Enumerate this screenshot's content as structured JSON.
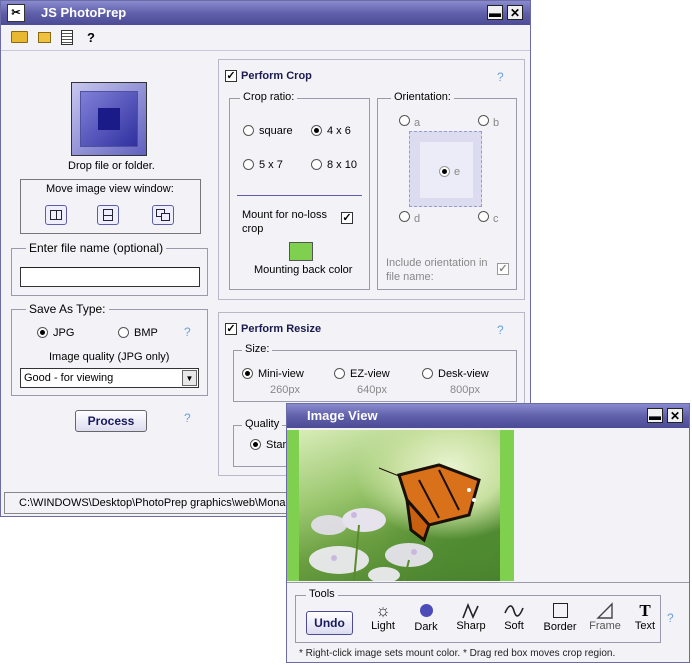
{
  "main": {
    "title": "JS PhotoPrep",
    "toolbar": {
      "help_label": "?"
    },
    "drop": {
      "label": "Drop file or folder."
    },
    "move_view": {
      "label": "Move image view window:"
    },
    "file_name": {
      "label": "Enter file name (optional)",
      "value": ""
    },
    "save_as": {
      "label": "Save As Type:",
      "jpg_label": "JPG",
      "bmp_label": "BMP",
      "selected": "JPG",
      "quality_label": "Image quality (JPG only)",
      "quality_value": "Good - for viewing",
      "help": "?"
    },
    "process": {
      "label": "Process",
      "help": "?"
    },
    "crop": {
      "enabled_label": "Perform Crop",
      "checked_mark": "✓",
      "help": "?",
      "ratio_label": "Crop ratio:",
      "ratios": [
        "square",
        "4 x 6",
        "5 x 7",
        "8 x 10"
      ],
      "selected_ratio": "4 x 6",
      "mount_label_1": "Mount for no-loss",
      "mount_label_2": "crop",
      "mount_color": "#80d050",
      "mount_color_label": "Mounting back color",
      "orientation_label": "Orientation:",
      "orientations": [
        "a",
        "b",
        "c",
        "d",
        "e"
      ],
      "selected_orientation": "e",
      "include_orient_1": "Include orientation in",
      "include_orient_2": "file name:"
    },
    "resize": {
      "enabled_label": "Perform Resize",
      "help": "?",
      "size_label": "Size:",
      "sizes": [
        {
          "name": "Mini-view",
          "px": "260px"
        },
        {
          "name": "EZ-view",
          "px": "640px"
        },
        {
          "name": "Desk-view",
          "px": "800px"
        }
      ],
      "selected_size": "Mini-view",
      "quality_label": "Quality",
      "quality_option": "Star"
    },
    "status_path": "C:\\WINDOWS\\Desktop\\PhotoPrep graphics\\web\\Mona"
  },
  "image_view": {
    "title": "Image View",
    "tools_label": "Tools",
    "undo_label": "Undo",
    "tools": [
      {
        "label": "Light",
        "icon": "sun-icon"
      },
      {
        "label": "Dark",
        "icon": "circle-icon"
      },
      {
        "label": "Sharp",
        "icon": "zigzag-icon"
      },
      {
        "label": "Soft",
        "icon": "wave-icon"
      },
      {
        "label": "Border",
        "icon": "square-icon"
      },
      {
        "label": "Frame",
        "icon": "parallelogram-icon"
      },
      {
        "label": "Text",
        "icon": "text-icon"
      }
    ],
    "help": "?",
    "hint": "* Right-click image sets mount color.  * Drag red box moves crop region.",
    "mount_color": "#80d050"
  }
}
